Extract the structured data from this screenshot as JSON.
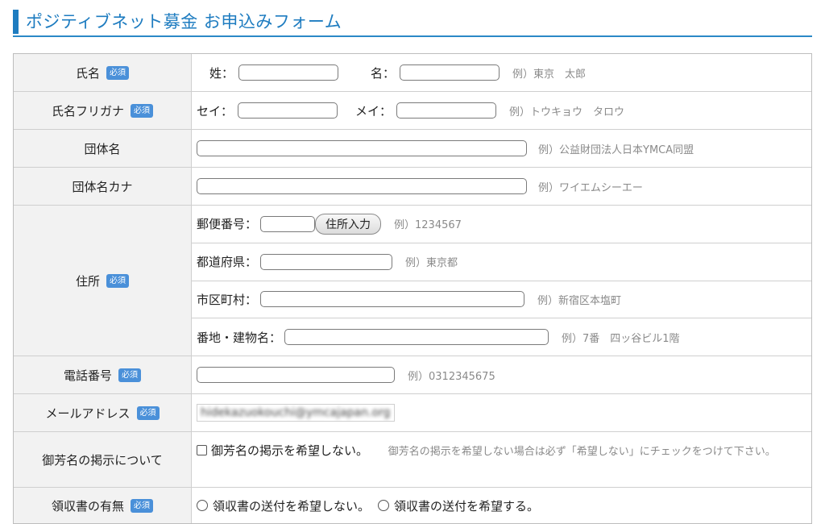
{
  "header": {
    "title": "ポジティブネット募金 お申込みフォーム"
  },
  "required_badge": "必須",
  "name": {
    "label": "氏名",
    "last_label": "姓：",
    "first_label": "名：",
    "example": "例）東京　太郎"
  },
  "furigana": {
    "label": "氏名フリガナ",
    "last_label": "セイ：",
    "first_label": "メイ：",
    "example": "例）トウキョウ　タロウ"
  },
  "org": {
    "label": "団体名",
    "example": "例）公益財団法人日本YMCA同盟"
  },
  "org_kana": {
    "label": "団体名カナ",
    "example": "例）ワイエムシーエー"
  },
  "address": {
    "label": "住所",
    "postal_label": "郵便番号：",
    "lookup_button": "住所入力",
    "postal_example": "例）1234567",
    "prefecture_label": "都道府県：",
    "prefecture_example": "例）東京都",
    "city_label": "市区町村：",
    "city_example": "例）新宿区本塩町",
    "street_label": "番地・建物名：",
    "street_example": "例）7番　四ッ谷ビル1階"
  },
  "phone": {
    "label": "電話番号",
    "example": "例）0312345675"
  },
  "email": {
    "label": "メールアドレス",
    "value": "hidekazuokouchi@ymcajapan.org"
  },
  "display_name": {
    "label": "御芳名の掲示について",
    "checkbox_label": "御芳名の掲示を希望しない。",
    "note": "御芳名の掲示を希望しない場合は必ず「希望しない」にチェックをつけて下さい。"
  },
  "receipt": {
    "label": "領収書の有無",
    "option_no": "領収書の送付を希望しない。",
    "option_yes": "領収書の送付を希望する。"
  }
}
